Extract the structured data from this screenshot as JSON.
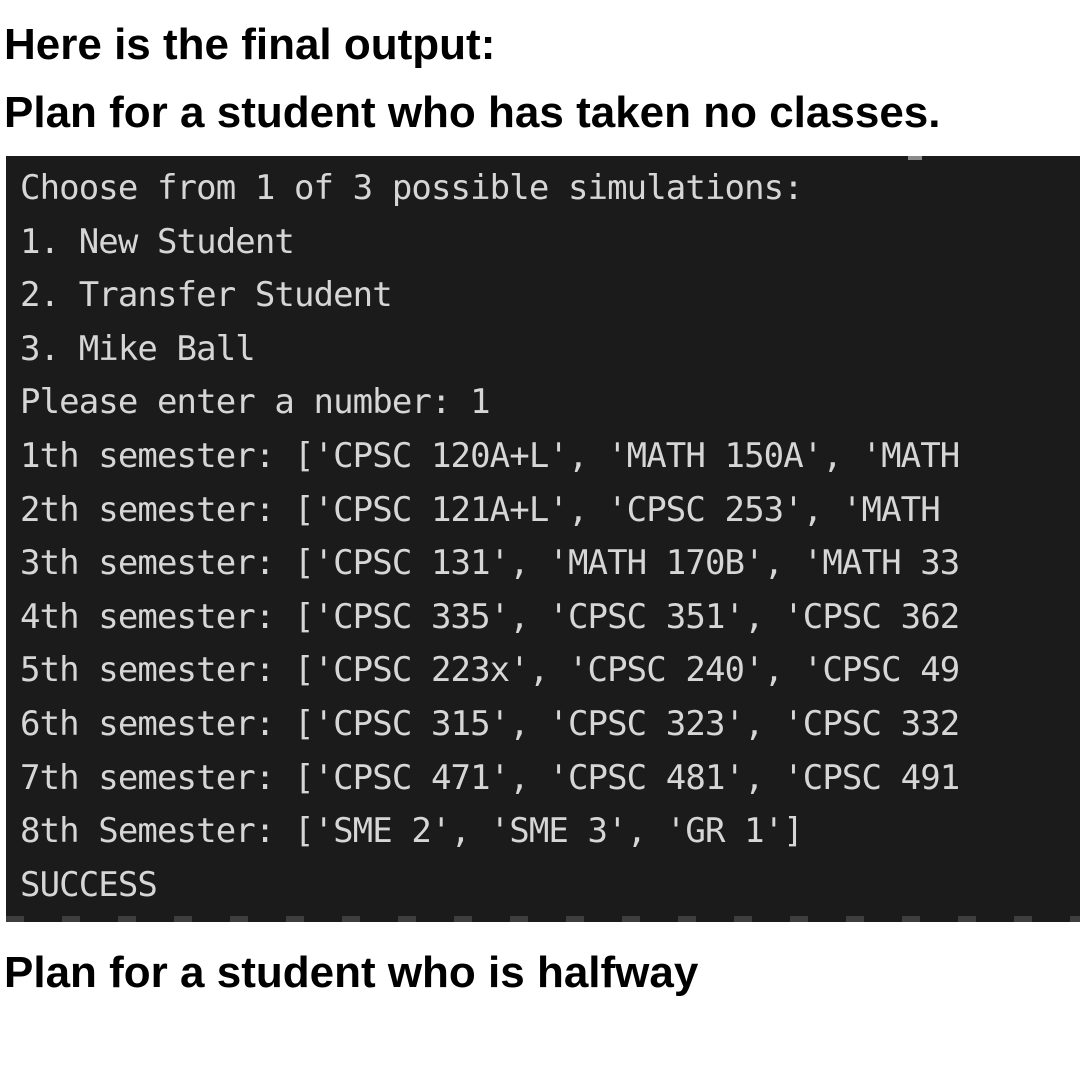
{
  "headings": {
    "intro": "Here is the final output:",
    "new_plan": "Plan for a student who has taken no classes.",
    "halfway_plan": "Plan for a student who is halfway"
  },
  "terminal": {
    "background": "#1b1b1b",
    "text_color": "#d6d6d6",
    "lines": [
      "Choose from 1 of 3 possible simulations:",
      "1. New Student",
      "2. Transfer Student",
      "3. Mike Ball",
      "Please enter a number: 1",
      "1th semester: ['CPSC 120A+L', 'MATH 150A', 'MATH",
      "2th semester: ['CPSC 121A+L', 'CPSC 253', 'MATH",
      "3th semester: ['CPSC 131', 'MATH 170B', 'MATH 33",
      "4th semester: ['CPSC 335', 'CPSC 351', 'CPSC 362",
      "5th semester: ['CPSC 223x', 'CPSC 240', 'CPSC 49",
      "6th semester: ['CPSC 315', 'CPSC 323', 'CPSC 332",
      "7th semester: ['CPSC 471', 'CPSC 481', 'CPSC 491",
      "8th Semester: ['SME 2', 'SME 3', 'GR 1']",
      "SUCCESS"
    ]
  }
}
